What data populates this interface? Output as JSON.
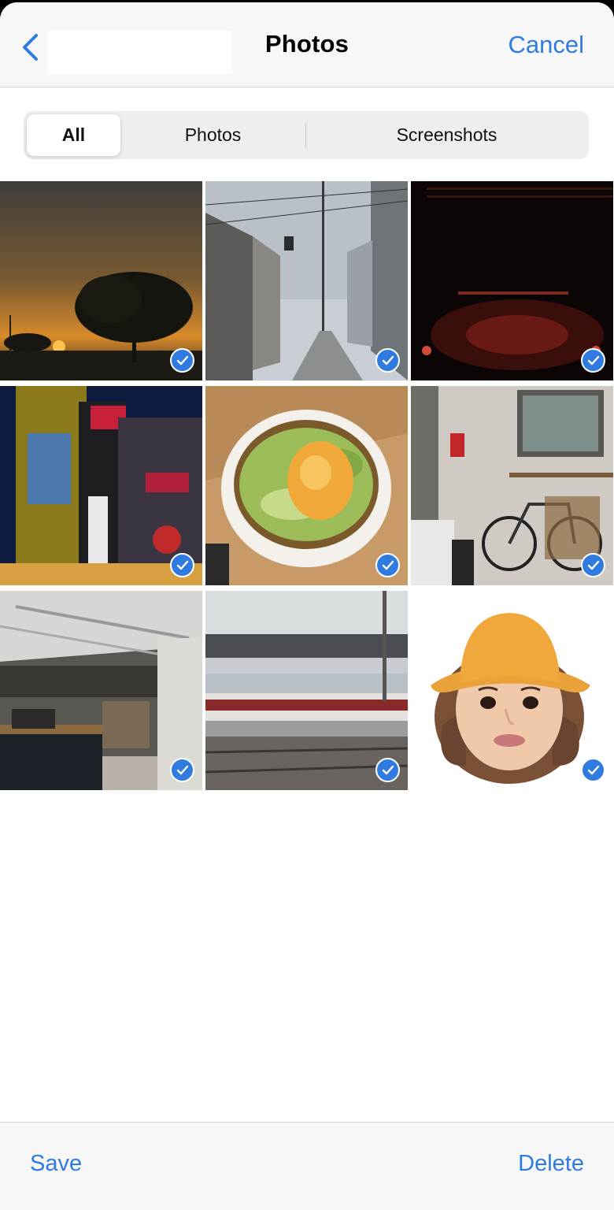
{
  "navbar": {
    "title": "Photos",
    "cancel_label": "Cancel",
    "back_icon": "chevron-left-icon"
  },
  "filter": {
    "segments": [
      "All",
      "Photos",
      "Screenshots"
    ],
    "selected": "All"
  },
  "grid": {
    "selection_icon": "checkmark-circle-icon",
    "accent_color": "#2f7be0",
    "items": [
      {
        "subject": "sunset tree",
        "selected": true
      },
      {
        "subject": "street with power lines",
        "selected": true
      },
      {
        "subject": "dark concert stage",
        "selected": true
      },
      {
        "subject": "night city buildings with signs",
        "selected": true
      },
      {
        "subject": "bowl with green onions and egg",
        "selected": true
      },
      {
        "subject": "bicycle in cafe",
        "selected": true
      },
      {
        "subject": "cafe interior",
        "selected": true
      },
      {
        "subject": "train station platform",
        "selected": true
      },
      {
        "subject": "memoji with orange bucket hat",
        "selected": true
      }
    ]
  },
  "toolbar": {
    "save_label": "Save",
    "delete_label": "Delete"
  }
}
